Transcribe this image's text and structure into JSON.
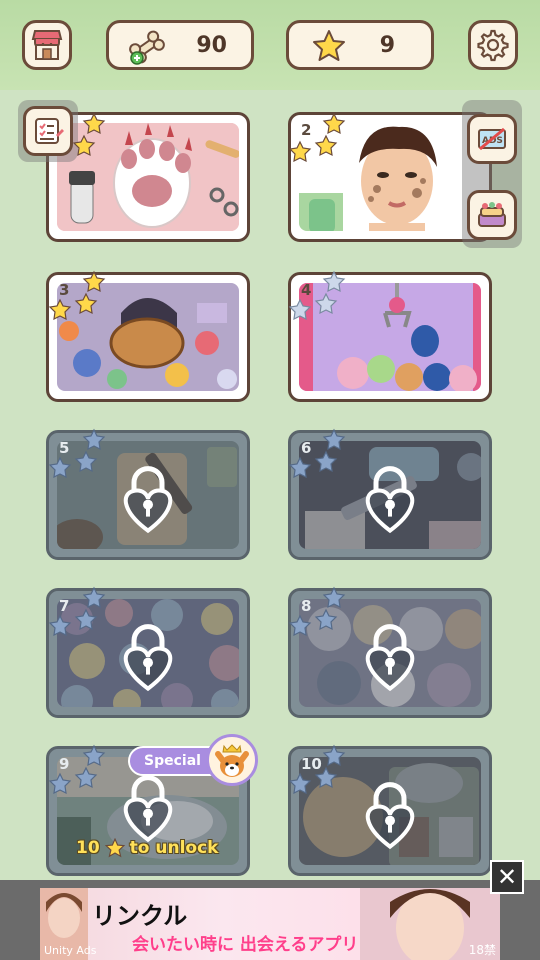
{
  "header": {
    "shop_icon": "shop-icon",
    "bones_icon": "bone-icon",
    "bones_count": "90",
    "star_icon": "star-icon",
    "stars_count": "9",
    "settings_icon": "gear-icon"
  },
  "side_buttons": {
    "tasks_icon": "checklist-icon",
    "no_ads_icon": "no-ads-icon",
    "gift_icon": "cake-icon"
  },
  "levels": [
    {
      "number": "",
      "theme": "cat paw grooming",
      "locked": false
    },
    {
      "number": "2",
      "theme": "face skincare",
      "locked": false
    },
    {
      "number": "3",
      "theme": "messy toy room",
      "locked": false
    },
    {
      "number": "4",
      "theme": "claw machine",
      "locked": false
    },
    {
      "number": "5",
      "theme": "baking dough",
      "locked": true
    },
    {
      "number": "6",
      "theme": "medical kit",
      "locked": true
    },
    {
      "number": "7",
      "theme": "buttons",
      "locked": true
    },
    {
      "number": "8",
      "theme": "cats pile",
      "locked": true
    },
    {
      "number": "9",
      "theme": "special cat bed",
      "locked": true
    },
    {
      "number": "10",
      "theme": "corgi bento",
      "locked": true
    }
  ],
  "special": {
    "label": "Special",
    "unlock_count": "10",
    "unlock_text": "to unlock"
  },
  "ad": {
    "title": "リンクル",
    "subtitle": "会いたい時に 出会えるアプリ",
    "age": "18禁",
    "unity_label": "Unity Ads",
    "close_label": "✕"
  },
  "colors": {
    "background": "#cfe3c3",
    "topbar": "#b9dba4",
    "border_brown": "#6b4b3a",
    "panel_cream": "#fbf3e4",
    "star_yellow": "#ffd84a",
    "special_purple": "#a98de0",
    "unlock_yellow": "#ffe15a"
  }
}
